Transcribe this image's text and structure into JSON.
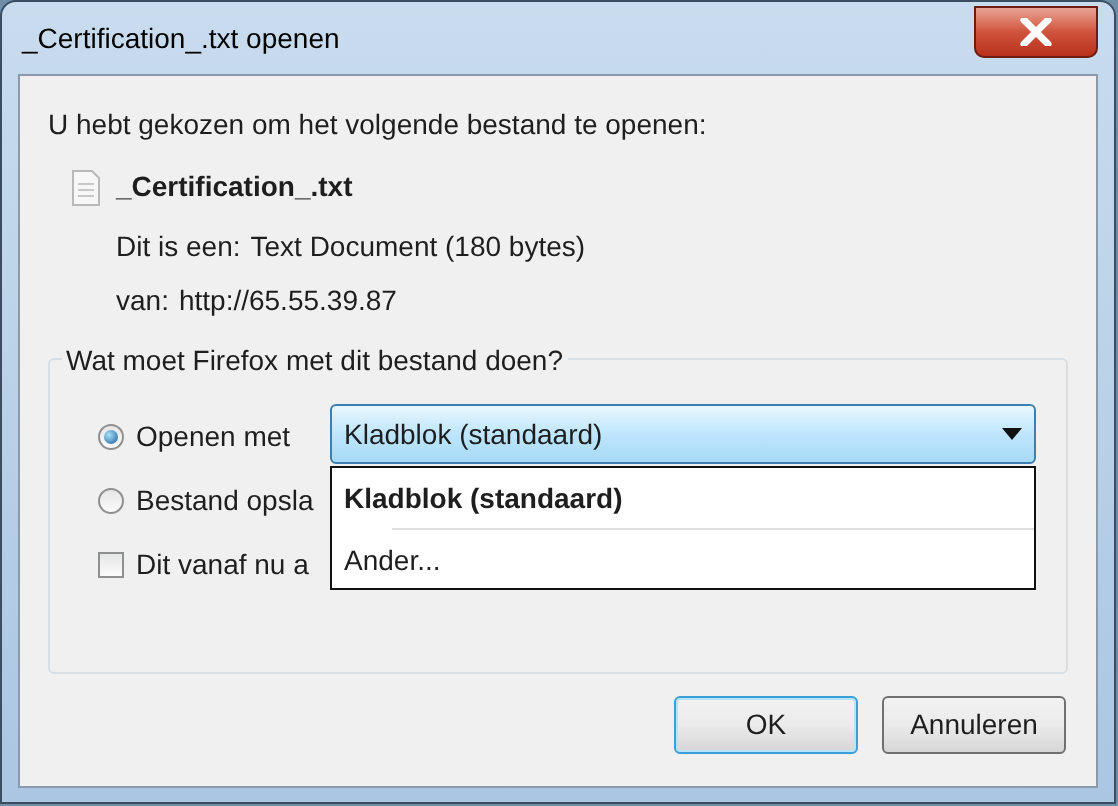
{
  "window": {
    "title": "_Certification_.txt openen"
  },
  "intro": "U hebt gekozen om het volgende bestand te openen:",
  "file": {
    "name": "_Certification_.txt",
    "type_label": "Dit is een:",
    "type": "Text Document (180 bytes)",
    "from_label": "van:",
    "from": "http://65.55.39.87"
  },
  "group": {
    "title": "Wat moet Firefox met dit bestand doen?",
    "options": [
      {
        "kind": "radio",
        "label": "Openen met",
        "selected": true
      },
      {
        "kind": "radio",
        "label": "Bestand opsla",
        "selected": false
      },
      {
        "kind": "checkbox",
        "label": "Dit vanaf nu a",
        "checked": false
      }
    ],
    "combo": {
      "value": "Kladblok (standaard)",
      "expanded": true,
      "options": [
        {
          "label": "Kladblok (standaard)",
          "selected": true
        },
        {
          "label": "Ander...",
          "selected": false
        }
      ]
    }
  },
  "buttons": [
    {
      "label": "OK",
      "default": true
    },
    {
      "label": "Annuleren",
      "default": false
    }
  ]
}
